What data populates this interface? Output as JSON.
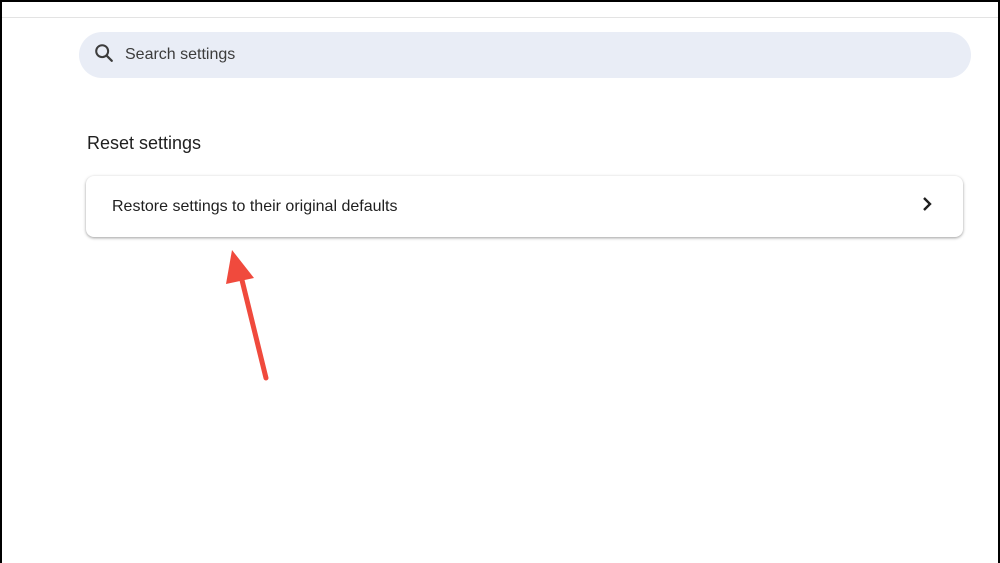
{
  "search": {
    "placeholder": "Search settings",
    "icon": "search-icon"
  },
  "section": {
    "title": "Reset settings"
  },
  "items": [
    {
      "label": "Restore settings to their original defaults",
      "icon": "chevron-right-icon"
    }
  ],
  "annotation": {
    "color": "#f04a3d"
  }
}
